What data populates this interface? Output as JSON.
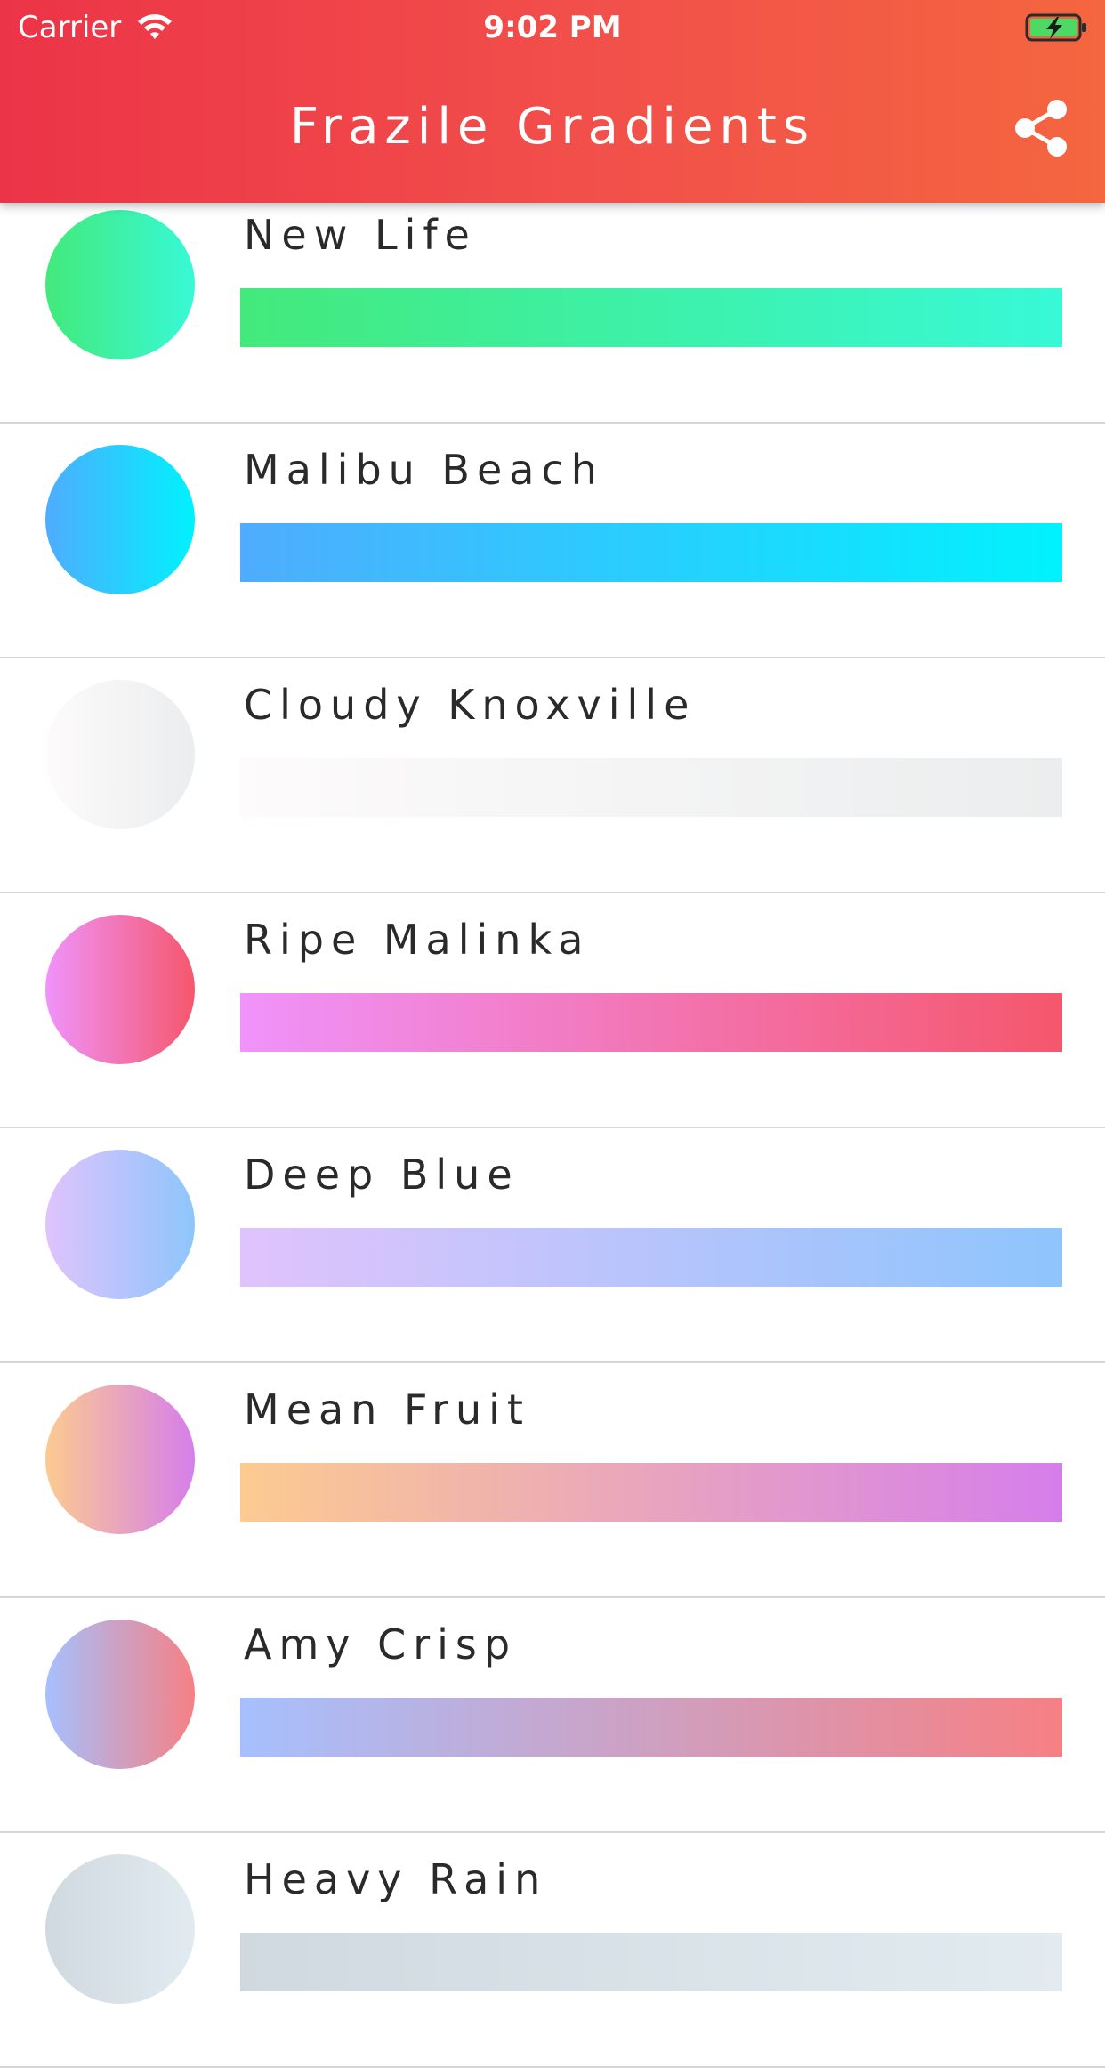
{
  "status_bar": {
    "carrier": "Carrier",
    "time": "9:02 PM"
  },
  "app_bar": {
    "title": "Frazile Gradients",
    "share_icon": "share-icon",
    "background_colors": [
      "#ec3448",
      "#f4663f"
    ]
  },
  "gradients": [
    {
      "name": "New Life",
      "colors": [
        "#43e97b",
        "#38f9d7"
      ]
    },
    {
      "name": "Malibu Beach",
      "colors": [
        "#4facfe",
        "#00f2fe"
      ]
    },
    {
      "name": "Cloudy Knoxville",
      "colors": [
        "#fdfbfb",
        "#ebedee"
      ]
    },
    {
      "name": "Ripe Malinka",
      "colors": [
        "#f093fb",
        "#f5576c"
      ]
    },
    {
      "name": "Deep Blue",
      "colors": [
        "#e0c3fc",
        "#8ec5fc"
      ]
    },
    {
      "name": "Mean Fruit",
      "colors": [
        "#fccb90",
        "#d57eeb"
      ]
    },
    {
      "name": "Amy Crisp",
      "colors": [
        "#a6c0fe",
        "#f68084"
      ]
    },
    {
      "name": "Heavy Rain",
      "colors": [
        "#cfd9df",
        "#e2ebf0"
      ]
    }
  ]
}
